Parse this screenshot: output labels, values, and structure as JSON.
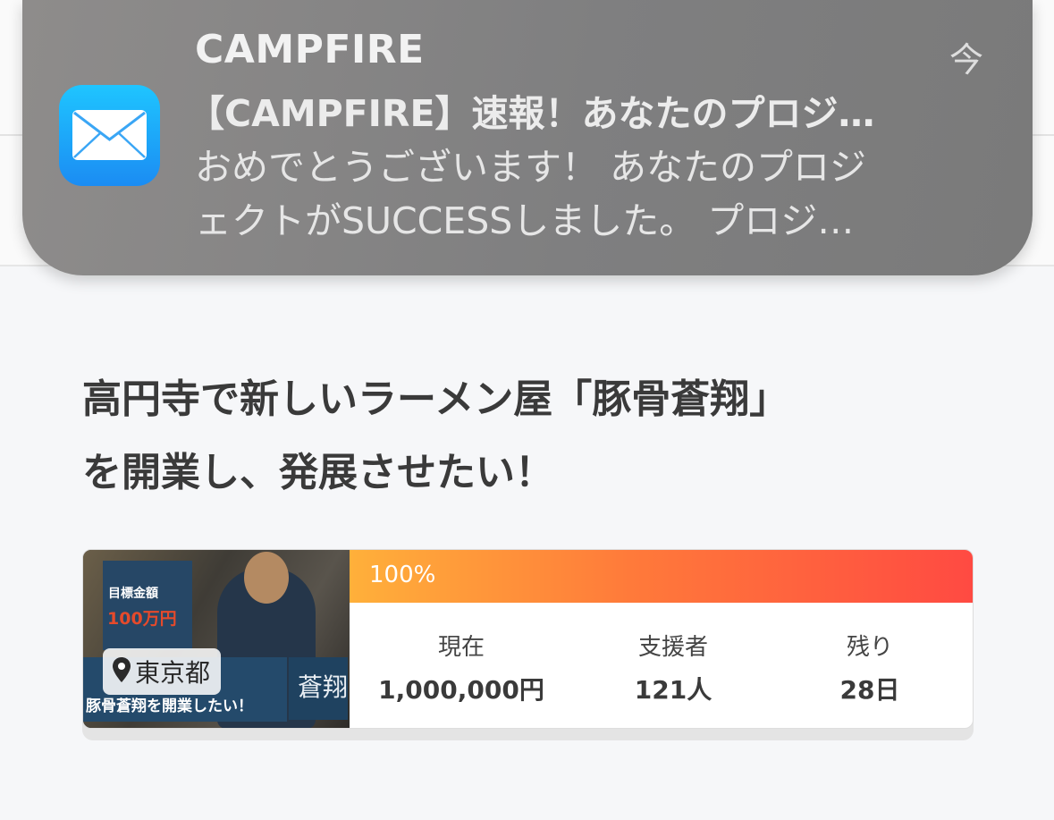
{
  "notification": {
    "app_name": "CAMPFIRE",
    "time": "今",
    "subject": "【CAMPFIRE】速報！あなたのプロジ…",
    "body_line1": "おめでとうございます！ あなたのプロジ",
    "body_line2": "ェクトがSUCCESSしました。 プロジ…",
    "icon": "mail-icon"
  },
  "project": {
    "title_line1": "高円寺で新しいラーメン屋「豚骨蒼翔」",
    "title_line2": "を開業し、発展させたい！",
    "thumbnail": {
      "goal_label": "目標金額",
      "goal_amount": "100万円",
      "banner_text": "豚骨蒼翔を開業したい！",
      "logo_text": "蒼翔"
    },
    "location": "東京都",
    "progress": {
      "label": "100%",
      "percent": 100
    },
    "stats": [
      {
        "label": "現在",
        "value": "1,000,000円"
      },
      {
        "label": "支援者",
        "value": "121人"
      },
      {
        "label": "残り",
        "value": "28日"
      }
    ]
  },
  "colors": {
    "progress_start": "#ffb03a",
    "progress_end": "#ff4a42",
    "mail_icon": "#1b8cf3"
  }
}
